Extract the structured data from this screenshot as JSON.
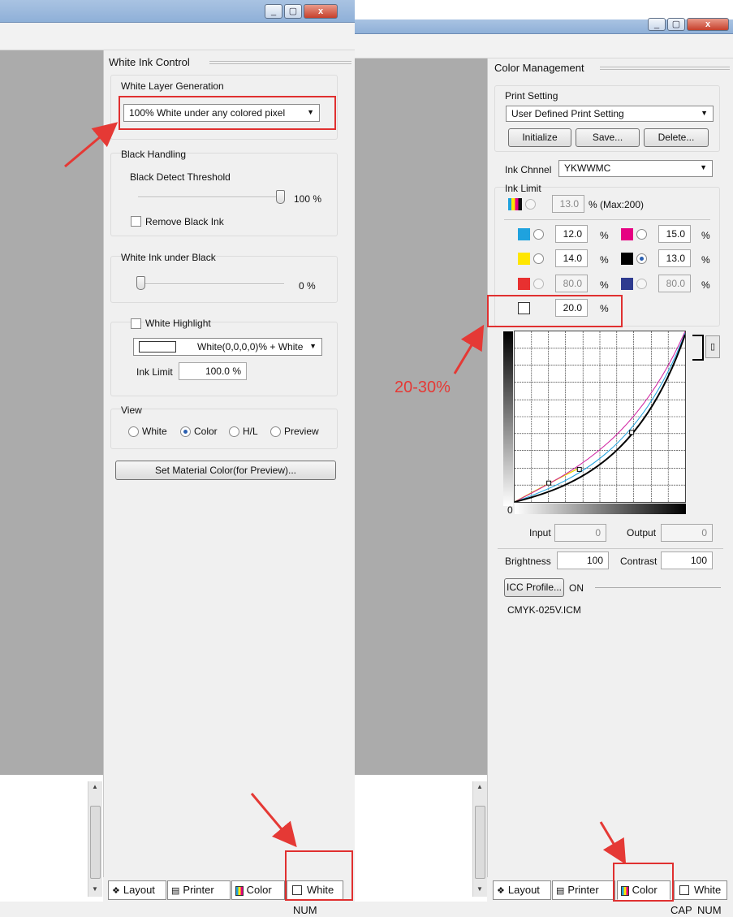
{
  "left": {
    "window_buttons": [
      "_",
      "▢",
      "x"
    ],
    "panel_title": "White Ink Control",
    "white_layer": {
      "label": "White Layer Generation",
      "selected": "100% White under any colored pixel"
    },
    "black_handling": {
      "label": "Black Handling",
      "threshold_label": "Black Detect Threshold",
      "threshold_value": "100 %",
      "threshold_level": 1.0,
      "remove_black_label": "Remove Black Ink"
    },
    "white_under_black": {
      "label": "White Ink under Black",
      "value": "0 %",
      "level": 0.0
    },
    "white_highlight": {
      "label": "White Highlight",
      "selected": "White(0,0,0,0)% + White",
      "ink_limit_label": "Ink Limit",
      "ink_limit_value": "100.0 %"
    },
    "view": {
      "label": "View",
      "options": [
        "White",
        "Color",
        "H/L",
        "Preview"
      ],
      "selected": "Color"
    },
    "set_material_button": "Set Material Color(for Preview)...",
    "tabs": [
      "Layout",
      "Printer",
      "Color",
      "White"
    ],
    "status": [
      "NUM"
    ]
  },
  "right": {
    "window_buttons": [
      "_",
      "▢",
      "x"
    ],
    "panel_title": "Color Management",
    "print_setting": {
      "label": "Print Setting",
      "selected": "User Defined Print Setting",
      "buttons": [
        "Initialize",
        "Save...",
        "Delete..."
      ]
    },
    "ink_channel": {
      "label": "Ink Chnnel",
      "selected": "YKWWMC"
    },
    "ink_limit": {
      "label": "Ink Limit",
      "total_value": "13.0",
      "total_suffix": "% (Max:200)",
      "channels": [
        {
          "color": "#1fa2de",
          "value": "12.0",
          "unit": "%",
          "selected": false,
          "disabled": false
        },
        {
          "color": "#e60082",
          "value": "15.0",
          "unit": "%",
          "selected": false,
          "disabled": false
        },
        {
          "color": "#ffe600",
          "value": "14.0",
          "unit": "%",
          "selected": false,
          "disabled": false
        },
        {
          "color": "#000000",
          "value": "13.0",
          "unit": "%",
          "selected": true,
          "disabled": false
        },
        {
          "color": "#e83030",
          "value": "80.0",
          "unit": "%",
          "selected": false,
          "disabled": true
        },
        {
          "color": "#2e3b8f",
          "value": "80.0",
          "unit": "%",
          "selected": false,
          "disabled": true
        }
      ],
      "white_value": "20.0",
      "white_unit": "%"
    },
    "curve": {
      "origin_label": "0"
    },
    "input_label": "Input",
    "input_value": "0",
    "output_label": "Output",
    "output_value": "0",
    "brightness_label": "Brightness",
    "brightness_value": "100",
    "contrast_label": "Contrast",
    "contrast_value": "100",
    "icc_button": "ICC Profile...",
    "icc_state": "ON",
    "icc_file": "CMYK-025V.ICM",
    "tabs": [
      "Layout",
      "Printer",
      "Color",
      "White"
    ],
    "status": [
      "CAP",
      "NUM"
    ]
  },
  "annotation": {
    "text": "20-30%"
  }
}
